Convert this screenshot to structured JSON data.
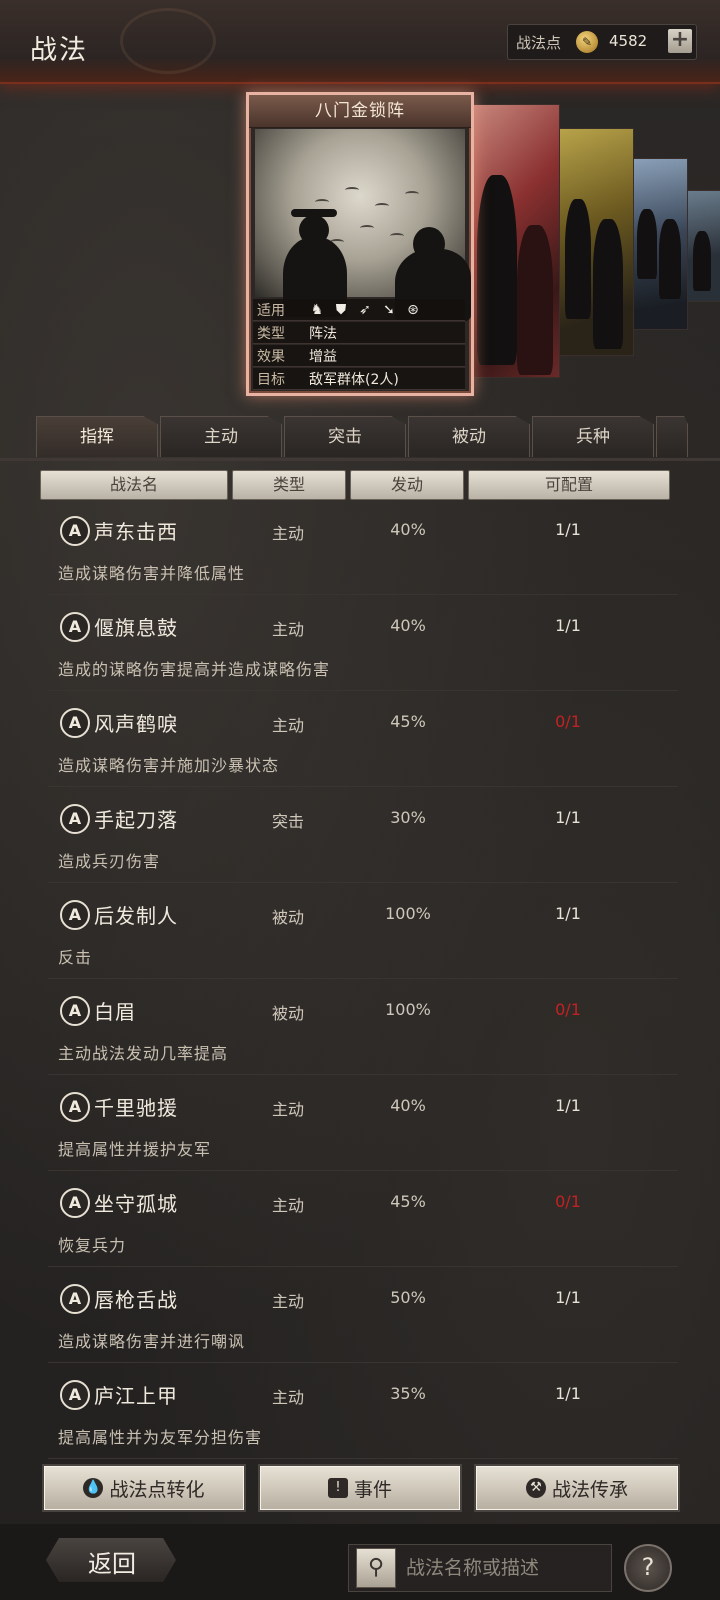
{
  "header": {
    "title": "战法",
    "points_label": "战法点",
    "points_value": "4582",
    "plus_label": "+"
  },
  "card": {
    "name": "八门金锁阵",
    "info": [
      {
        "key": "适用",
        "value": ""
      },
      {
        "key": "类型",
        "value": "阵法"
      },
      {
        "key": "效果",
        "value": "增益"
      },
      {
        "key": "目标",
        "value": "敌军群体(2人)"
      }
    ],
    "arm_icons": [
      "cavalry-icon",
      "shield-icon",
      "bow-icon",
      "spear-icon",
      "wheel-icon"
    ]
  },
  "tabs": [
    "指挥",
    "主动",
    "突击",
    "被动",
    "兵种"
  ],
  "columns": [
    "战法名",
    "类型",
    "发动",
    "可配置"
  ],
  "skills": [
    {
      "grade": "A",
      "name": "声东击西",
      "type": "主动",
      "rate": "40%",
      "slot": "1/1",
      "slot_red": false,
      "desc": "造成谋略伤害并降低属性"
    },
    {
      "grade": "A",
      "name": "偃旗息鼓",
      "type": "主动",
      "rate": "40%",
      "slot": "1/1",
      "slot_red": false,
      "desc": "造成的谋略伤害提高并造成谋略伤害"
    },
    {
      "grade": "A",
      "name": "风声鹤唳",
      "type": "主动",
      "rate": "45%",
      "slot": "0/1",
      "slot_red": true,
      "desc": "造成谋略伤害并施加沙暴状态"
    },
    {
      "grade": "A",
      "name": "手起刀落",
      "type": "突击",
      "rate": "30%",
      "slot": "1/1",
      "slot_red": false,
      "desc": "造成兵刃伤害"
    },
    {
      "grade": "A",
      "name": "后发制人",
      "type": "被动",
      "rate": "100%",
      "slot": "1/1",
      "slot_red": false,
      "desc": "反击"
    },
    {
      "grade": "A",
      "name": "白眉",
      "type": "被动",
      "rate": "100%",
      "slot": "0/1",
      "slot_red": true,
      "desc": "主动战法发动几率提高"
    },
    {
      "grade": "A",
      "name": "千里驰援",
      "type": "主动",
      "rate": "40%",
      "slot": "1/1",
      "slot_red": false,
      "desc": "提高属性并援护友军"
    },
    {
      "grade": "A",
      "name": "坐守孤城",
      "type": "主动",
      "rate": "45%",
      "slot": "0/1",
      "slot_red": true,
      "desc": "恢复兵力"
    },
    {
      "grade": "A",
      "name": "唇枪舌战",
      "type": "主动",
      "rate": "50%",
      "slot": "1/1",
      "slot_red": false,
      "desc": "造成谋略伤害并进行嘲讽"
    },
    {
      "grade": "A",
      "name": "庐江上甲",
      "type": "主动",
      "rate": "35%",
      "slot": "1/1",
      "slot_red": false,
      "desc": "提高属性并为友军分担伤害"
    }
  ],
  "buttons": {
    "convert": "战法点转化",
    "events": "事件",
    "inherit": "战法传承"
  },
  "footer": {
    "back": "返回",
    "search_placeholder": "战法名称或描述",
    "help": "?"
  },
  "colors": {
    "accent_red": "#c42222",
    "header_glow": "#7a2e1c",
    "card_border": "#e8b3a3"
  }
}
